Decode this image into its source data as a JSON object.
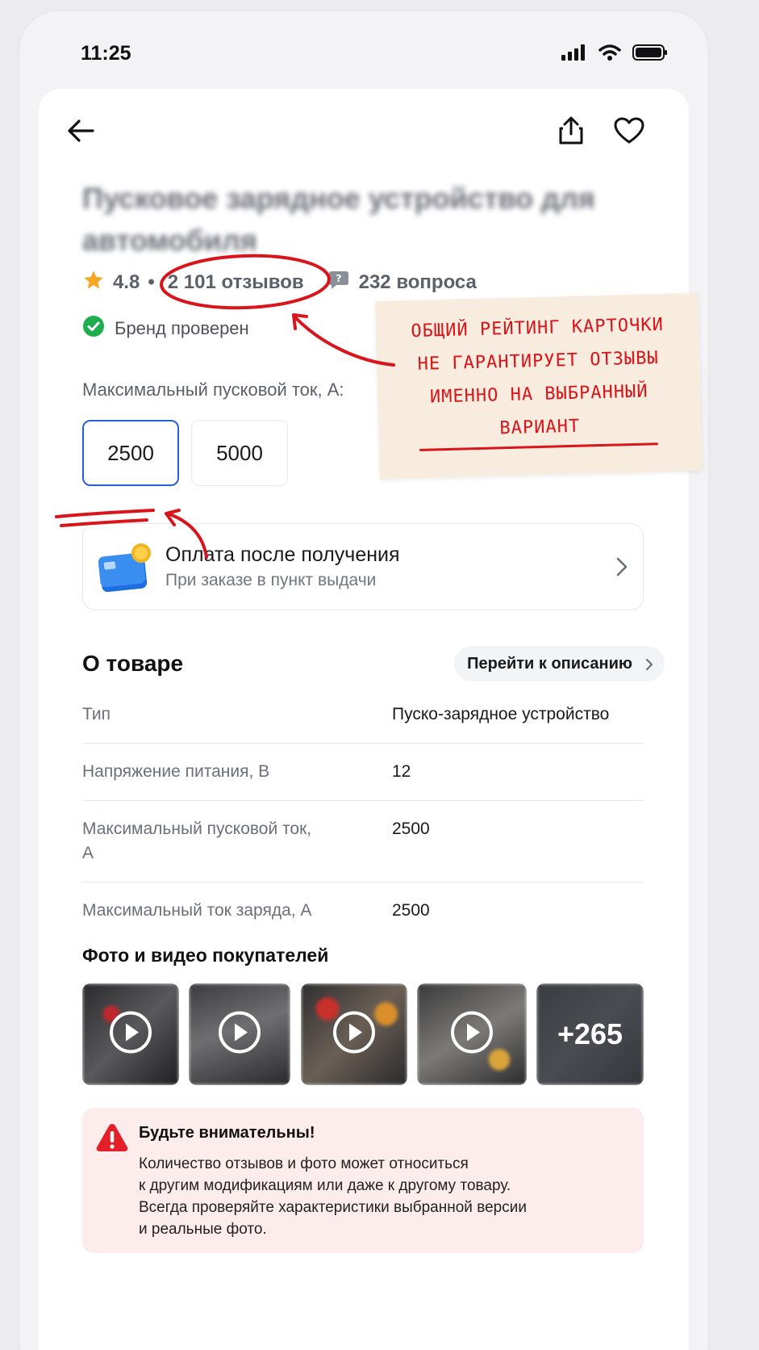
{
  "status_bar": {
    "time": "11:25"
  },
  "product": {
    "title": "Пусковое зарядное устройство для автомобиля",
    "rating": "4.8",
    "separator": "•",
    "reviews": "2 101 отзывов",
    "questions": "232 вопроса",
    "brand_verified": "Бренд проверен"
  },
  "variants": {
    "label": "Максимальный пусковой ток, А:",
    "options": [
      "2500",
      "5000"
    ],
    "selected": "2500"
  },
  "payment": {
    "title": "Оплата после получения",
    "subtitle": "При заказе в пункт выдачи"
  },
  "about": {
    "title": "О товаре",
    "link": "Перейти к описанию",
    "specs": [
      {
        "key": "Тип",
        "value": "Пуско-зарядное устройство"
      },
      {
        "key": "Напряжение питания, В",
        "value": "12"
      },
      {
        "key": "Максимальный пусковой ток, А",
        "value": "2500"
      },
      {
        "key": "Максимальный ток заряда, А",
        "value": "2500"
      }
    ]
  },
  "photos": {
    "title": "Фото и видео покупателей",
    "more_count": "+265"
  },
  "warning": {
    "title": "Будьте внимательны!",
    "text": "Количество отзывов и фото может относиться\nк другим модификациям или даже к другому товару.\nВсегда проверяйте характеристики выбранной версии\nи реальные фото."
  },
  "annotation": {
    "text": "ОБЩИЙ РЕЙТИНГ КАРТОЧКИ\nНЕ ГАРАНТИРУЕТ ОТЗЫВЫ\nИМЕННО НА ВЫБРАННЫЙ\nВАРИАНТ",
    "color": "#d9141b"
  },
  "colors": {
    "accent_blue": "#2860d8",
    "star": "#f5a623",
    "verified_green": "#1fad4e",
    "warning_bg": "#fdecec",
    "warning_icon": "#e3202a"
  }
}
